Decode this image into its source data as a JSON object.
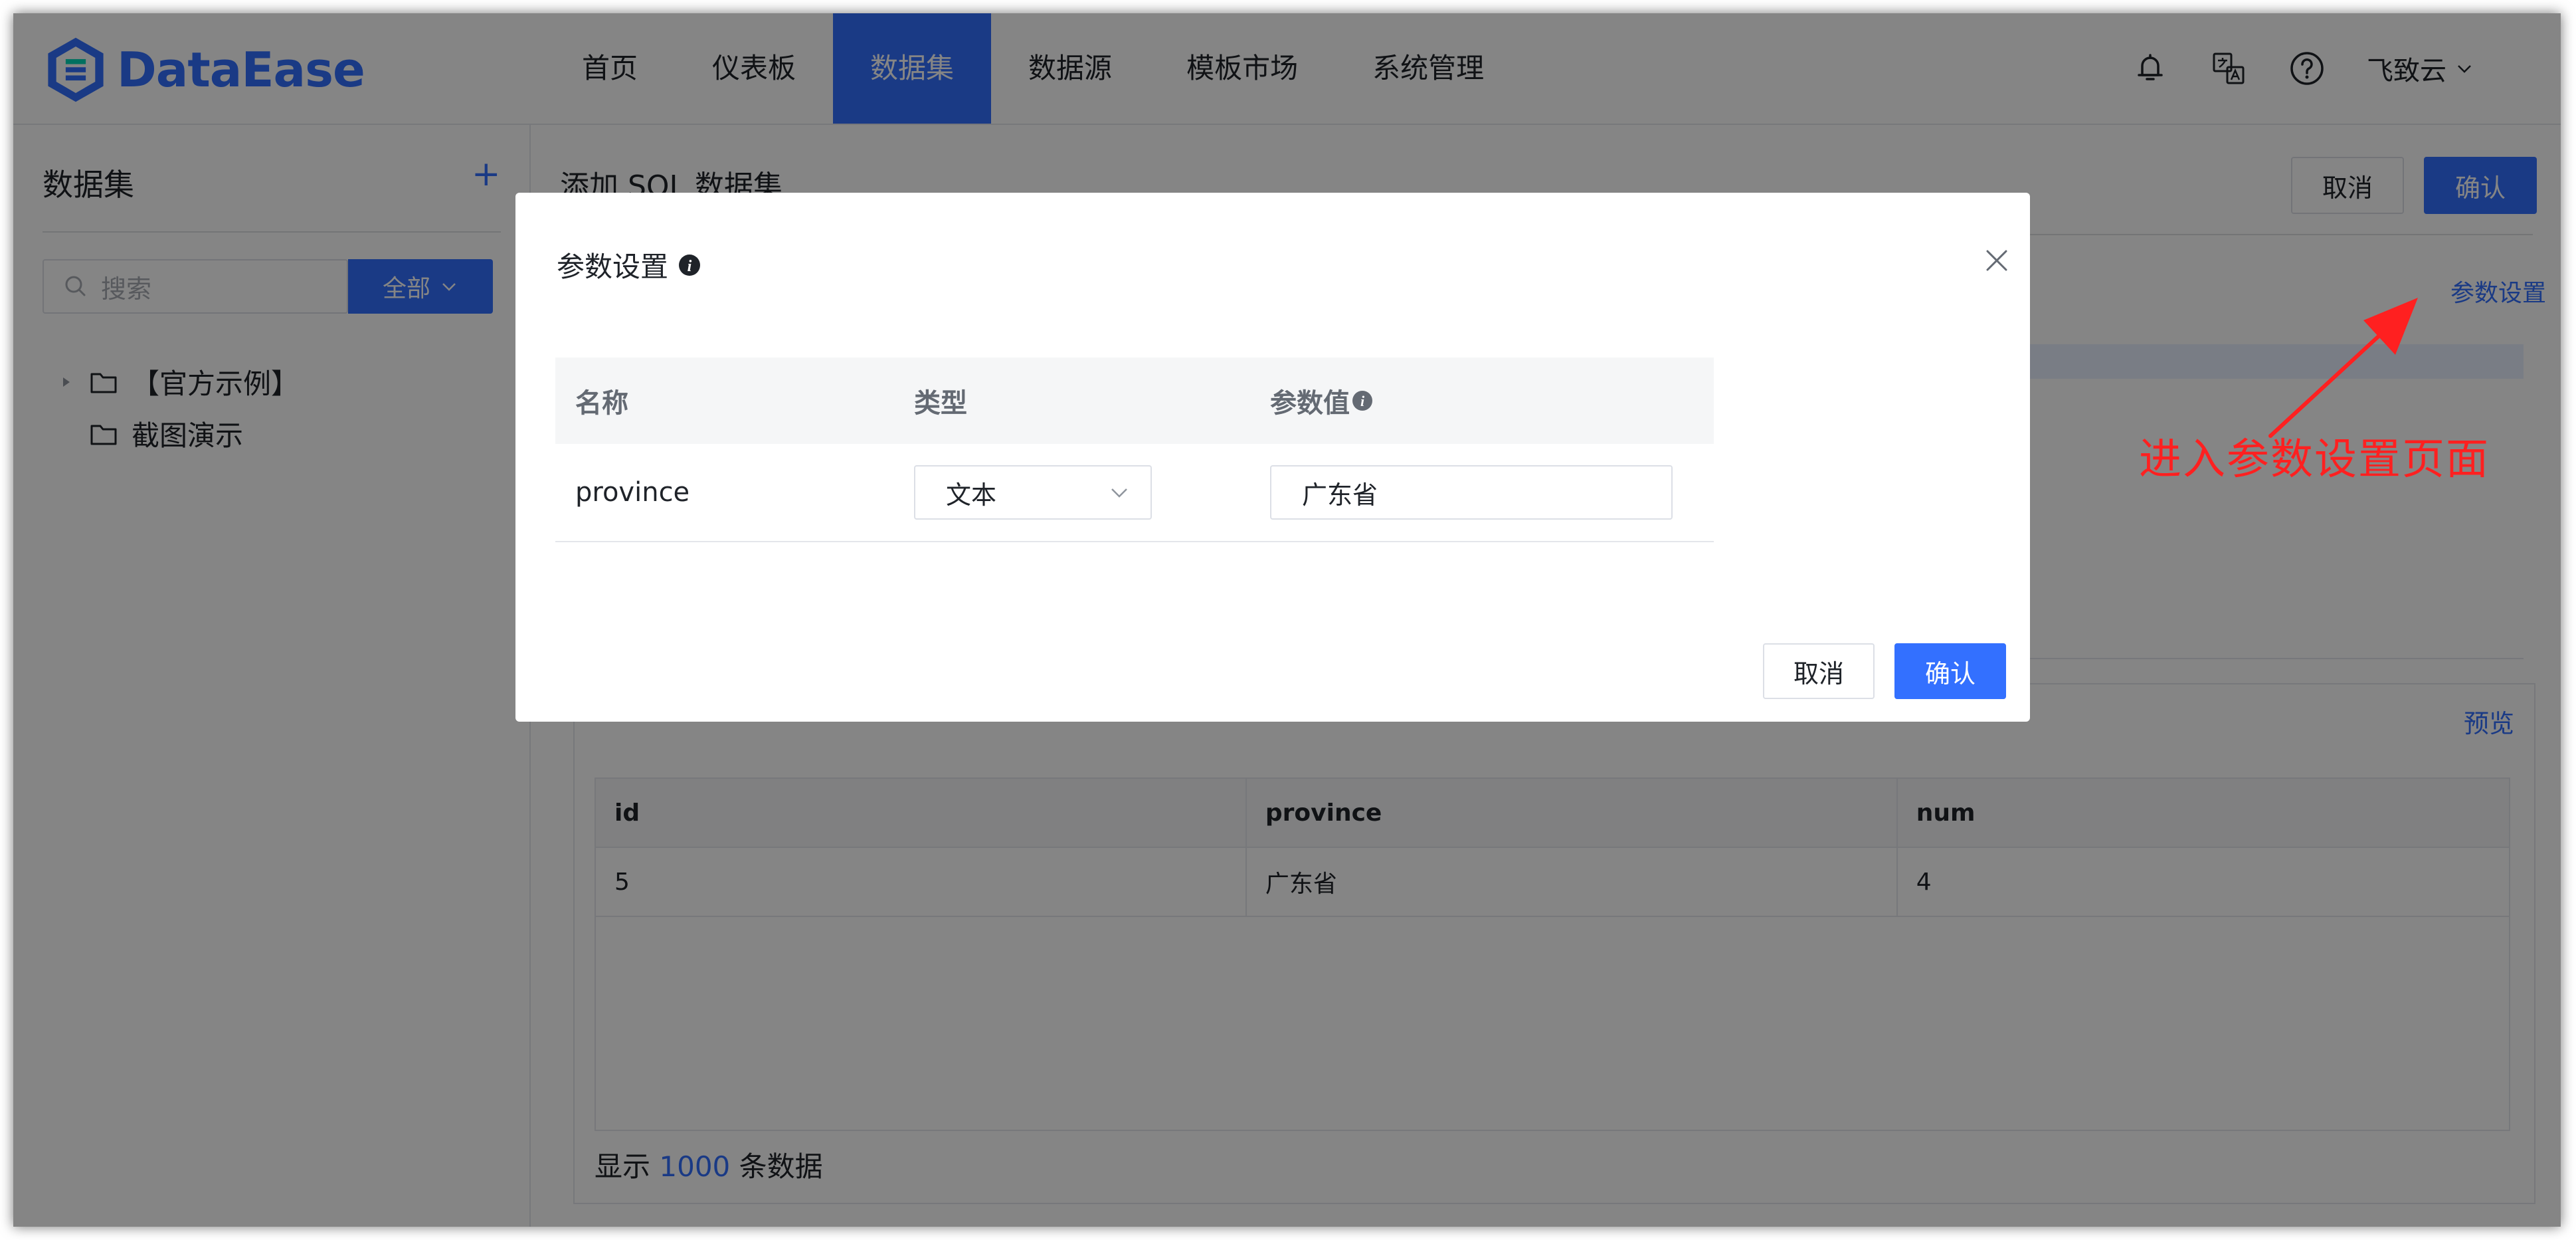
{
  "header": {
    "logo_text": "DataEase",
    "nav": [
      "首页",
      "仪表板",
      "数据集",
      "数据源",
      "模板市场",
      "系统管理"
    ],
    "active_nav": "数据集",
    "user_name": "飞致云",
    "icons": [
      "bell-icon",
      "translate-icon",
      "help-icon"
    ]
  },
  "sidebar": {
    "title": "数据集",
    "add_symbol": "+",
    "search_placeholder": "搜索",
    "filter_label": "全部",
    "tree": [
      {
        "label": "【官方示例】",
        "expandable": true
      },
      {
        "label": "截图演示",
        "expandable": false
      }
    ]
  },
  "main": {
    "title": "添加 SQL 数据集",
    "cancel_label": "取消",
    "confirm_label": "确认",
    "param_settings_link": "参数设置",
    "preview_link": "预览",
    "result_table": {
      "columns": [
        "id",
        "province",
        "num"
      ],
      "rows": [
        [
          "5",
          "广东省",
          "4"
        ]
      ]
    },
    "footer_prefix": "显示",
    "footer_count": "1000",
    "footer_suffix": "条数据"
  },
  "annotation": {
    "text": "进入参数设置页面",
    "color": "#ff2020"
  },
  "dialog": {
    "title": "参数设置",
    "columns": {
      "name": "名称",
      "type": "类型",
      "value": "参数值"
    },
    "rows": [
      {
        "name": "province",
        "type": "文本",
        "value": "广东省"
      }
    ],
    "cancel_label": "取消",
    "confirm_label": "确认"
  },
  "colors": {
    "primary": "#3370ff",
    "overlay": "rgba(0,0,0,0.48)",
    "annotation": "#ff2020"
  }
}
